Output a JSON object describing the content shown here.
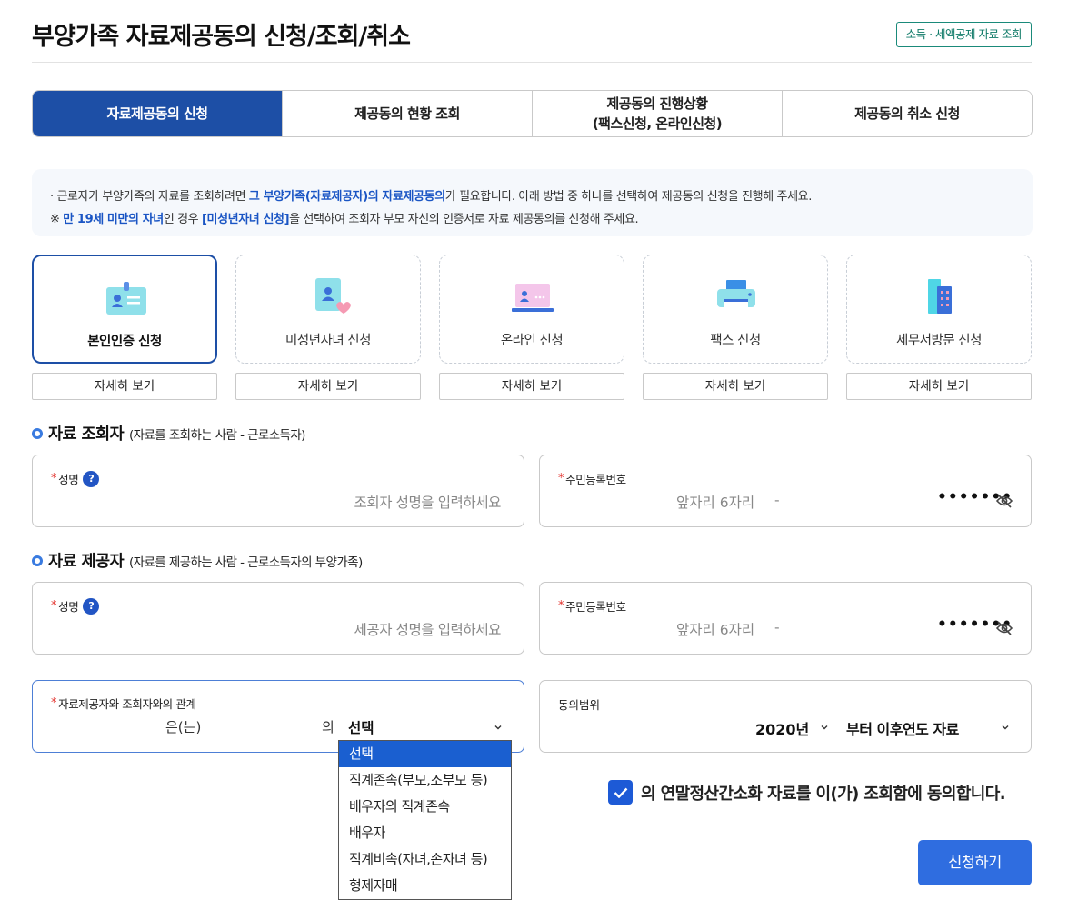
{
  "header": {
    "title": "부양가족 자료제공동의 신청/조회/취소",
    "top_link": "소득 · 세액공제 자료 조회"
  },
  "tabs": [
    {
      "label": "자료제공동의 신청",
      "active": true
    },
    {
      "label": "제공동의 현황 조회",
      "active": false
    },
    {
      "label_line1": "제공동의 진행상황",
      "label_line2": "(팩스신청, 온라인신청)",
      "active": false
    },
    {
      "label": "제공동의 취소 신청",
      "active": false
    }
  ],
  "notice": {
    "line1_pre": "· 근로자가 부양가족의 자료를 조회하려면 ",
    "line1_hl": "그 부양가족(자료제공자)의 자료제공동의",
    "line1_post": "가 필요합니다. 아래 방법 중 하나를 선택하여 제공동의 신청을 진행해 주세요.",
    "line2_pre": "※ ",
    "line2_hl1": "만 19세 미만의 자녀",
    "line2_mid": "인 경우 ",
    "line2_hl2": "[미성년자녀 신청]",
    "line2_post": "을 선택하여 조회자 부모 자신의 인증서로 자료 제공동의를 신청해 주세요."
  },
  "methods": [
    {
      "label": "본인인증 신청",
      "icon": "id-card-icon",
      "selected": true
    },
    {
      "label": "미성년자녀 신청",
      "icon": "child-card-icon",
      "selected": false
    },
    {
      "label": "온라인 신청",
      "icon": "laptop-icon",
      "selected": false
    },
    {
      "label": "팩스 신청",
      "icon": "fax-printer-icon",
      "selected": false
    },
    {
      "label": "세무서방문 신청",
      "icon": "building-icon",
      "selected": false
    }
  ],
  "detail_button_label": "자세히 보기",
  "requester": {
    "heading": "자료 조회자",
    "sub": "(자료를 조회하는 사람 - 근로소득자)",
    "name_label": "성명",
    "name_placeholder": "조회자 성명을 입력하세요",
    "rrn_label": "주민등록번호",
    "rrn_front_placeholder": "앞자리 6자리",
    "rrn_dash": "-",
    "rrn_back_mask": "•••••••"
  },
  "provider": {
    "heading": "자료 제공자",
    "sub": "(자료를 제공하는 사람 - 근로소득자의 부양가족)",
    "name_label": "성명",
    "name_placeholder": "제공자 성명을 입력하세요",
    "rrn_label": "주민등록번호",
    "rrn_front_placeholder": "앞자리 6자리",
    "rrn_dash": "-",
    "rrn_back_mask": "•••••••"
  },
  "relation": {
    "label": "자료제공자와 조회자와의 관계",
    "eun": "은(는)",
    "ui": "의",
    "selected": "선택",
    "options": [
      "선택",
      "직계존속(부모,조부모 등)",
      "배우자의 직계존속",
      "배우자",
      "직계비속(자녀,손자녀 등)",
      "형제자매"
    ]
  },
  "scope": {
    "label": "동의범위",
    "year": "2020년",
    "range": "부터 이후연도 자료"
  },
  "agree": {
    "checked": true,
    "text": "의 연말정산간소화 자료를 이(가) 조회함에 동의합니다."
  },
  "submit_label": "신청하기",
  "colors": {
    "primary": "#1d4fa6",
    "accent_blue": "#2f6de0",
    "link_green": "#0f7a68",
    "required": "#e3342f"
  }
}
